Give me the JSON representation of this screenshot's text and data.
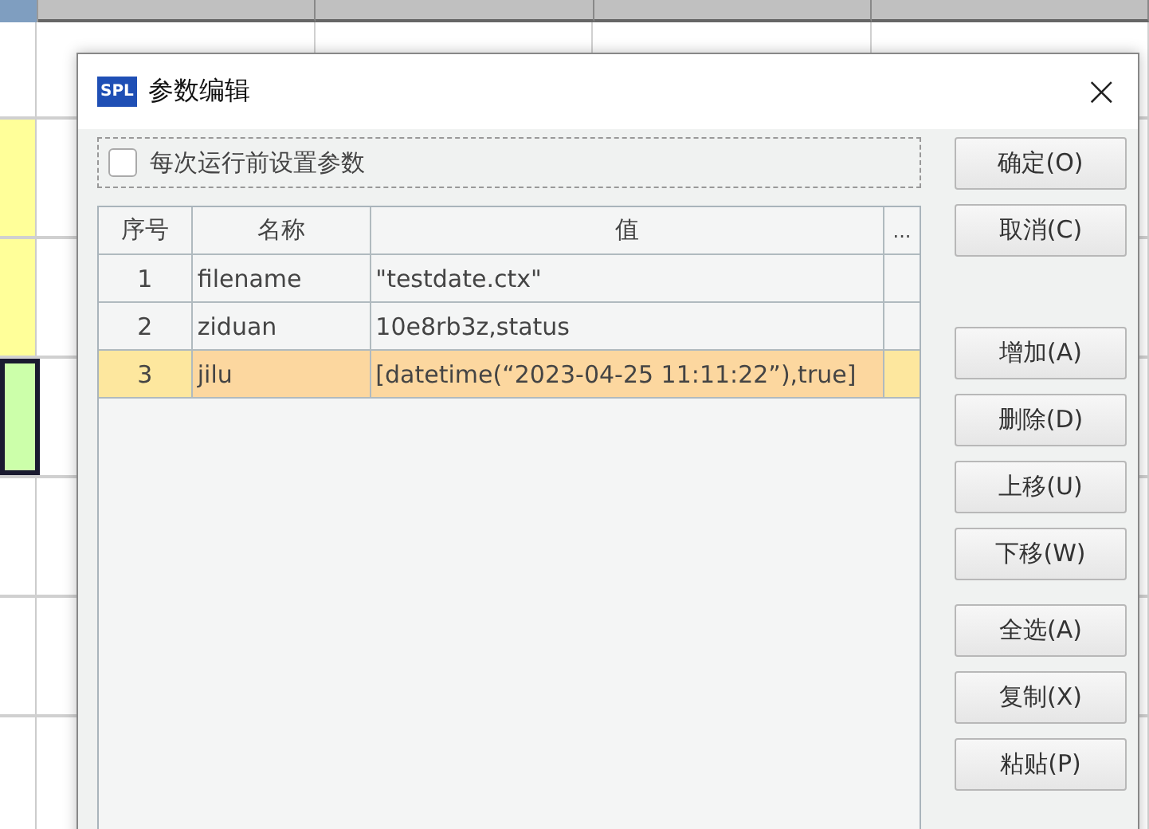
{
  "dialog": {
    "title": "参数编辑",
    "logo": "SPL",
    "close": "×"
  },
  "run_before": {
    "label": "每次运行前设置参数",
    "checked": false
  },
  "table": {
    "columns": [
      "序号",
      "名称",
      "值",
      "..."
    ],
    "rows": [
      {
        "index": "1",
        "name": "filename",
        "value": "\"testdate.ctx\"",
        "selected": false
      },
      {
        "index": "2",
        "name": "ziduan",
        "value": "10e8rb3z,status",
        "selected": false
      },
      {
        "index": "3",
        "name": "jilu",
        "value": "[datetime(“2023-04-25 11:11:22”),true]",
        "selected": true
      }
    ]
  },
  "button_groups": [
    [
      "确定(O)",
      "取消(C)"
    ],
    [
      "增加(A)",
      "删除(D)",
      "上移(U)",
      "下移(W)"
    ],
    [
      "全选(A)",
      "复制(X)",
      "粘贴(P)"
    ]
  ]
}
